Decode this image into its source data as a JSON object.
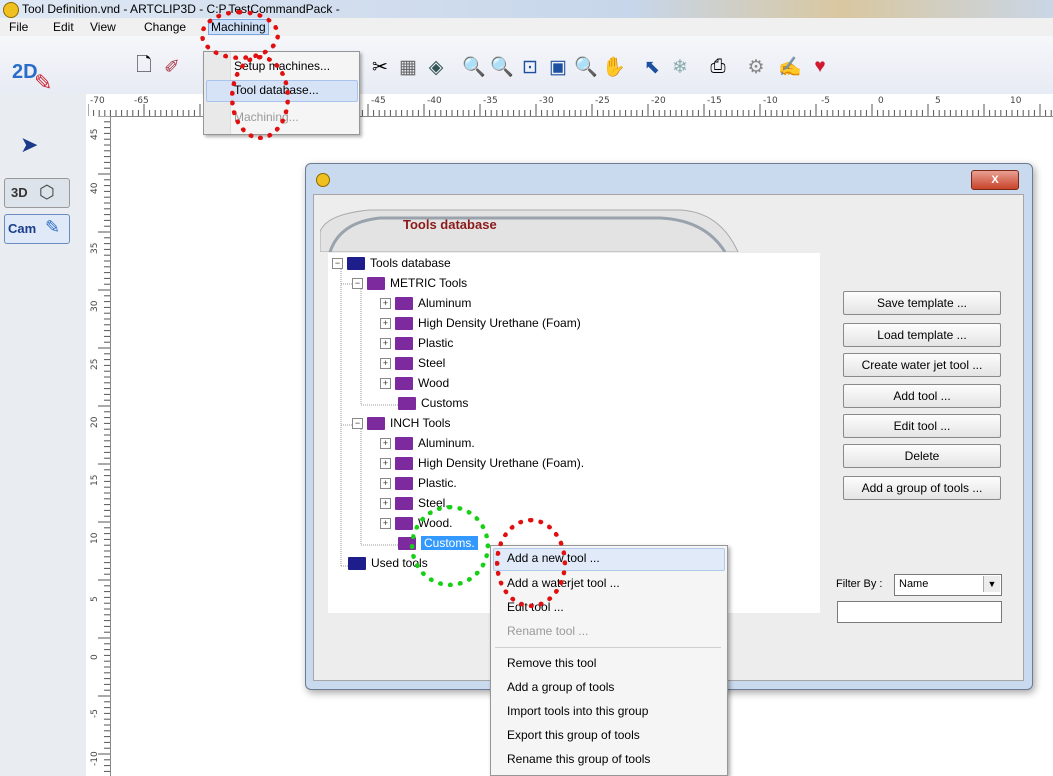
{
  "window": {
    "title": "Tool Definition.vnd - ARTCLIP3D  - C:P.TestCommandPack -"
  },
  "menubar": {
    "items": [
      "File",
      "Edit",
      "View",
      "Change",
      "Machining"
    ]
  },
  "left_panel": {
    "tab_2d": "2D",
    "tab_3d": "3D",
    "tab_cam": "Cam"
  },
  "ruler": {
    "horizontal": [
      "-70",
      "-65",
      "-45",
      "-40",
      "-35",
      "-30",
      "-25",
      "-20",
      "-15",
      "-10",
      "-5",
      "0",
      "5",
      "10"
    ],
    "vertical": [
      "45",
      "40",
      "35",
      "30",
      "25",
      "20",
      "15",
      "10",
      "5",
      "0",
      "-5",
      "-10"
    ]
  },
  "machining_menu": {
    "items": [
      "Setup machines...",
      "Tool database...",
      "Machining..."
    ]
  },
  "dialog": {
    "banner_title": "Tools database",
    "close_label": "X",
    "tree": {
      "root": "Tools database",
      "metric": {
        "label": "METRIC Tools",
        "children": [
          "Aluminum",
          "High Density Urethane (Foam)",
          "Plastic",
          "Steel",
          "Wood",
          "Customs"
        ]
      },
      "inch": {
        "label": "INCH Tools",
        "children": [
          "Aluminum.",
          "High Density Urethane (Foam).",
          "Plastic.",
          "Steel.",
          "Wood.",
          "Customs."
        ]
      },
      "used": "Used tools"
    },
    "buttons": [
      "Save template ...",
      "Load template ...",
      "Create water jet tool ...",
      "Add tool ...",
      "Edit tool ...",
      "Delete",
      "Add a group of tools ..."
    ],
    "filter_label": "Filter By :",
    "filter_value": "Name",
    "filter_text": ""
  },
  "context_menu": {
    "items": [
      "Add a new tool ...",
      "Add a waterjet tool ...",
      "Edit tool ...",
      "Rename tool ...",
      "Remove this tool",
      "Add a group of tools",
      "Import tools into this group",
      "Export this group of tools",
      "Rename this group of tools"
    ]
  },
  "colors": {
    "highlight_ring_red": "#e01010",
    "highlight_ring_green": "#16d016",
    "selection": "#3399ff"
  }
}
